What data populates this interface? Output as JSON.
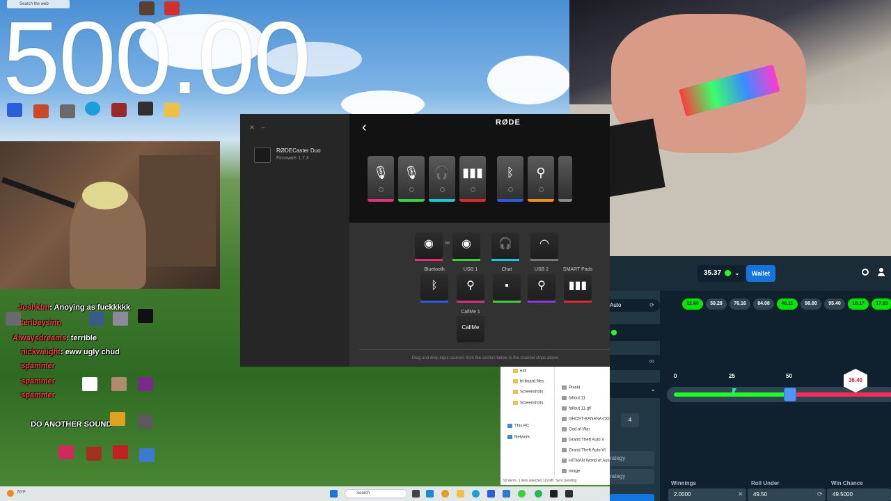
{
  "overlay": {
    "big_number": "500.00"
  },
  "desktop": {
    "search_placeholder": "Search the web"
  },
  "rode_app": {
    "device_name": "RØDECaster Duo",
    "firmware": "Firmware 1.7.3",
    "brand": "RØDE",
    "channels": [
      {
        "icon": "mic-1-icon",
        "glyph": "🎙",
        "color": "#e0307a"
      },
      {
        "icon": "mic-2-icon",
        "glyph": "🎙",
        "color": "#3ad13a"
      },
      {
        "icon": "headphones-icon",
        "glyph": "🎧",
        "color": "#18c8d8"
      },
      {
        "icon": "soundpad-icon",
        "glyph": "▮▮▮",
        "color": "#e02828"
      },
      {
        "icon": "bluetooth-icon",
        "glyph": "ᛒ",
        "color": "#2a5be0"
      },
      {
        "icon": "usb-icon",
        "glyph": "⚲",
        "color": "#f08a18"
      }
    ],
    "sources_top_labels": [
      "",
      "",
      "",
      ""
    ],
    "sources": [
      {
        "label": "Bluetooth",
        "icon": "bluetooth-icon",
        "glyph": "ᛒ",
        "color": "#2a5be0"
      },
      {
        "label": "USB 1",
        "icon": "usb-icon",
        "glyph": "⚲",
        "color": "#e0307a"
      },
      {
        "label": "Chat",
        "icon": "chat-icon",
        "glyph": "▪",
        "color": "#3ad13a"
      },
      {
        "label": "USB 2",
        "icon": "usb-icon",
        "glyph": "⚲",
        "color": "#8a3ae0"
      },
      {
        "label": "SMART Pads",
        "icon": "soundpad-icon",
        "glyph": "▮▮▮",
        "color": "#e02828"
      }
    ],
    "callme_label": "CallMe 1",
    "callme_pad": "CallMe",
    "hint": "Drag and drop input sources from the section below to the channel strips above"
  },
  "chat": {
    "lines": [
      {
        "user": "Joshktm",
        "msg": ": Anoying as fuckkkkk"
      },
      {
        "user": "tenbeysinn",
        "msg": ""
      },
      {
        "user": "Alwaysdreams",
        "msg": ": terrible"
      },
      {
        "user": "nickweight",
        "msg": ": eww ugly chud"
      },
      {
        "user": "spammer",
        "msg": ""
      },
      {
        "user": "spammer",
        "msg": ""
      },
      {
        "user": "spammer",
        "msg": ""
      },
      {
        "user": "",
        "msg": "DO ANOTHER SOUND"
      }
    ]
  },
  "explorer": {
    "items": [
      "exit",
      "bl-board.files",
      "Screenshots",
      "Screenshots",
      "This PC",
      "Network",
      "Pixel4",
      "fallout 11",
      "fallout 11.gif",
      "GHOST-BANANA-DOOM",
      "God of War",
      "Grand Theft Auto V",
      "Grand Theft Auto VI",
      "HITMAN World of Assassination",
      "image"
    ],
    "status_items": "92 items",
    "status_selected": "1 item selected  129 kB",
    "status_sync": "Sync pending"
  },
  "dice": {
    "balance": "35.37",
    "wallet_label": "Wallet",
    "mode_label": "Auto",
    "history": [
      {
        "value": "22.68",
        "win": true
      },
      {
        "value": "59.28",
        "win": false
      },
      {
        "value": "76.16",
        "win": false
      },
      {
        "value": "84.08",
        "win": false
      },
      {
        "value": "46.11",
        "win": true
      },
      {
        "value": "98.80",
        "win": false
      },
      {
        "value": "95.40",
        "win": false
      },
      {
        "value": "10.17",
        "win": true
      },
      {
        "value": "17.03",
        "win": true
      }
    ],
    "scale": [
      "0",
      "25",
      "50"
    ],
    "result": "36.40",
    "roll_under_fraction": 0.495,
    "side_values": [
      "4"
    ],
    "side_labels": [
      "rategy",
      "rategy"
    ],
    "stats": {
      "winnings_label": "Winnings",
      "winnings_value": "2.0000",
      "roll_label": "Roll Under",
      "roll_value": "49.50",
      "chance_label": "Win Chance",
      "chance_value": "49.5000"
    }
  },
  "taskbar": {
    "search_label": "Search",
    "weather": "70°F"
  }
}
